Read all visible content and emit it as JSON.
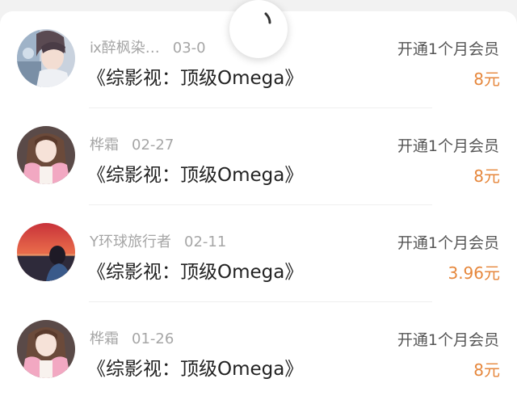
{
  "colors": {
    "price": "#e6873c",
    "meta_text": "#a6a6a6",
    "title_text": "#222222"
  },
  "loader": {
    "icon": "loading-spinner-icon"
  },
  "records": [
    {
      "user": "ⅸ醉枫染…",
      "date": "03-0",
      "title": "《综影视：顶级Omega》",
      "action": "开通1个月会员",
      "price": "8元",
      "avatar": "anime-boy-avatar"
    },
    {
      "user": "桦霜",
      "date": "02-27",
      "title": "《综影视：顶级Omega》",
      "action": "开通1个月会员",
      "price": "8元",
      "avatar": "girl-pink-coat-avatar"
    },
    {
      "user": "Y环球旅行者",
      "date": "02-11",
      "title": "《综影视：顶级Omega》",
      "action": "开通1个月会员",
      "price": "3.96元",
      "avatar": "sunset-avatar"
    },
    {
      "user": "桦霜",
      "date": "01-26",
      "title": "《综影视：顶级Omega》",
      "action": "开通1个月会员",
      "price": "8元",
      "avatar": "girl-pink-coat-avatar"
    }
  ]
}
